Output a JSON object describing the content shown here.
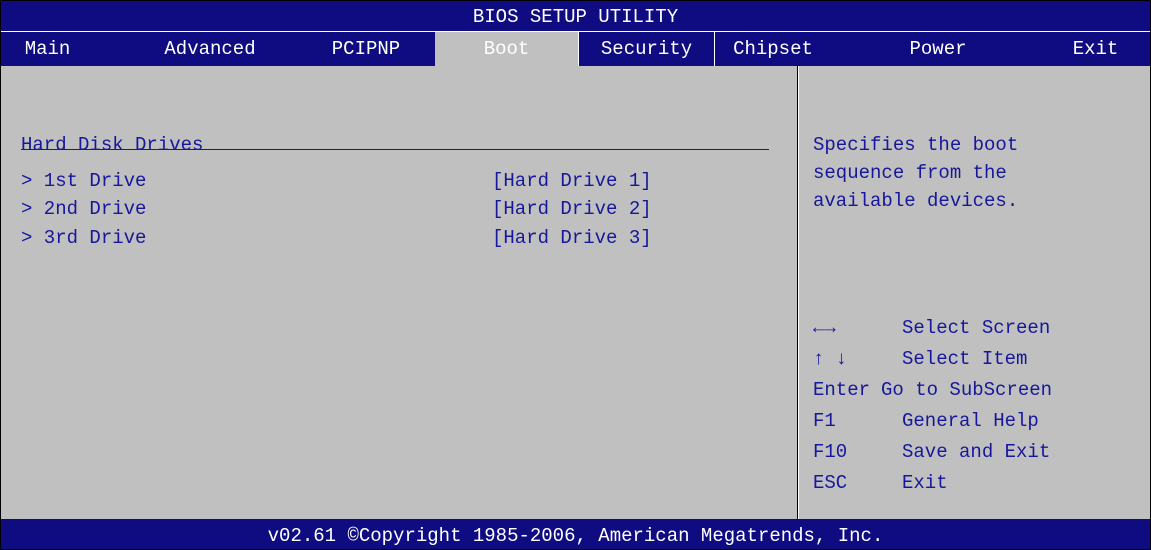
{
  "title": "BIOS SETUP UTILITY",
  "menu": [
    {
      "label": "Main"
    },
    {
      "label": "Advanced"
    },
    {
      "label": "PCIPNP"
    },
    {
      "label": "Boot"
    },
    {
      "label": "Security"
    },
    {
      "label": "Chipset"
    },
    {
      "label": "Power"
    },
    {
      "label": "Exit"
    }
  ],
  "active_tab": "Boot",
  "main": {
    "section_title": "Hard Disk Drives",
    "drives": [
      {
        "label": "> 1st Drive",
        "value": "[Hard Drive 1]"
      },
      {
        "label": "> 2nd Drive",
        "value": "[Hard Drive 2]"
      },
      {
        "label": "> 3rd Drive",
        "value": "[Hard Drive 3]"
      }
    ]
  },
  "help": {
    "lines": [
      "Specifies the boot",
      "sequence from the",
      "available devices."
    ]
  },
  "keys": [
    {
      "key": "←→",
      "desc": "Select Screen"
    },
    {
      "key": "↑ ↓",
      "desc": "Select Item"
    },
    {
      "key": "Enter",
      "desc": "Go to SubScreen"
    },
    {
      "key": "F1",
      "desc": "General Help"
    },
    {
      "key": "F10",
      "desc": "Save and Exit"
    },
    {
      "key": "ESC",
      "desc": "Exit"
    }
  ],
  "footer": "v02.61 ©Copyright 1985-2006, American Megatrends, Inc.",
  "colors": {
    "bar_blue": "#0f0b80",
    "panel_gray": "#c0c0c0",
    "text_blue": "#16179a",
    "bar_text": "#ffffff"
  }
}
